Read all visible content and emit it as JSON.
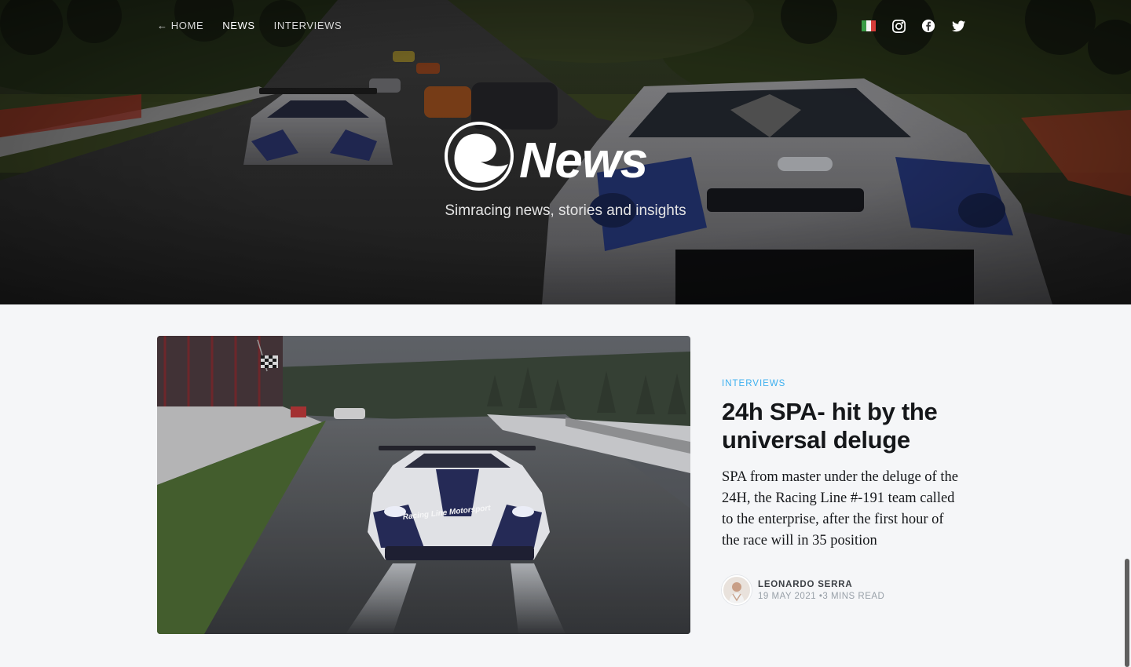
{
  "nav": {
    "home": "← HOME",
    "news": "NEWS",
    "interviews": "INTERVIEWS"
  },
  "social": {
    "icons": [
      "italy-flag-icon",
      "instagram-icon",
      "facebook-icon",
      "twitter-icon"
    ]
  },
  "hero": {
    "brand": "News",
    "tagline": "Simracing news, stories and insights"
  },
  "featured_post": {
    "tag": "INTERVIEWS",
    "title": "24h SPA- hit by the universal deluge",
    "excerpt": "SPA from master under the deluge of the 24H, the Racing Line #-191 team called to the enterprise, after the first hour of the race will in 35 position",
    "author": "LEONARDO SERRA",
    "date": "19 MAY 2021",
    "read_time": "•3 MINS READ",
    "car_livery": "Racing Line Motorsport"
  },
  "colors": {
    "accent": "#3eb0ef",
    "page_bg": "#f5f6f8",
    "text": "#15171a"
  }
}
